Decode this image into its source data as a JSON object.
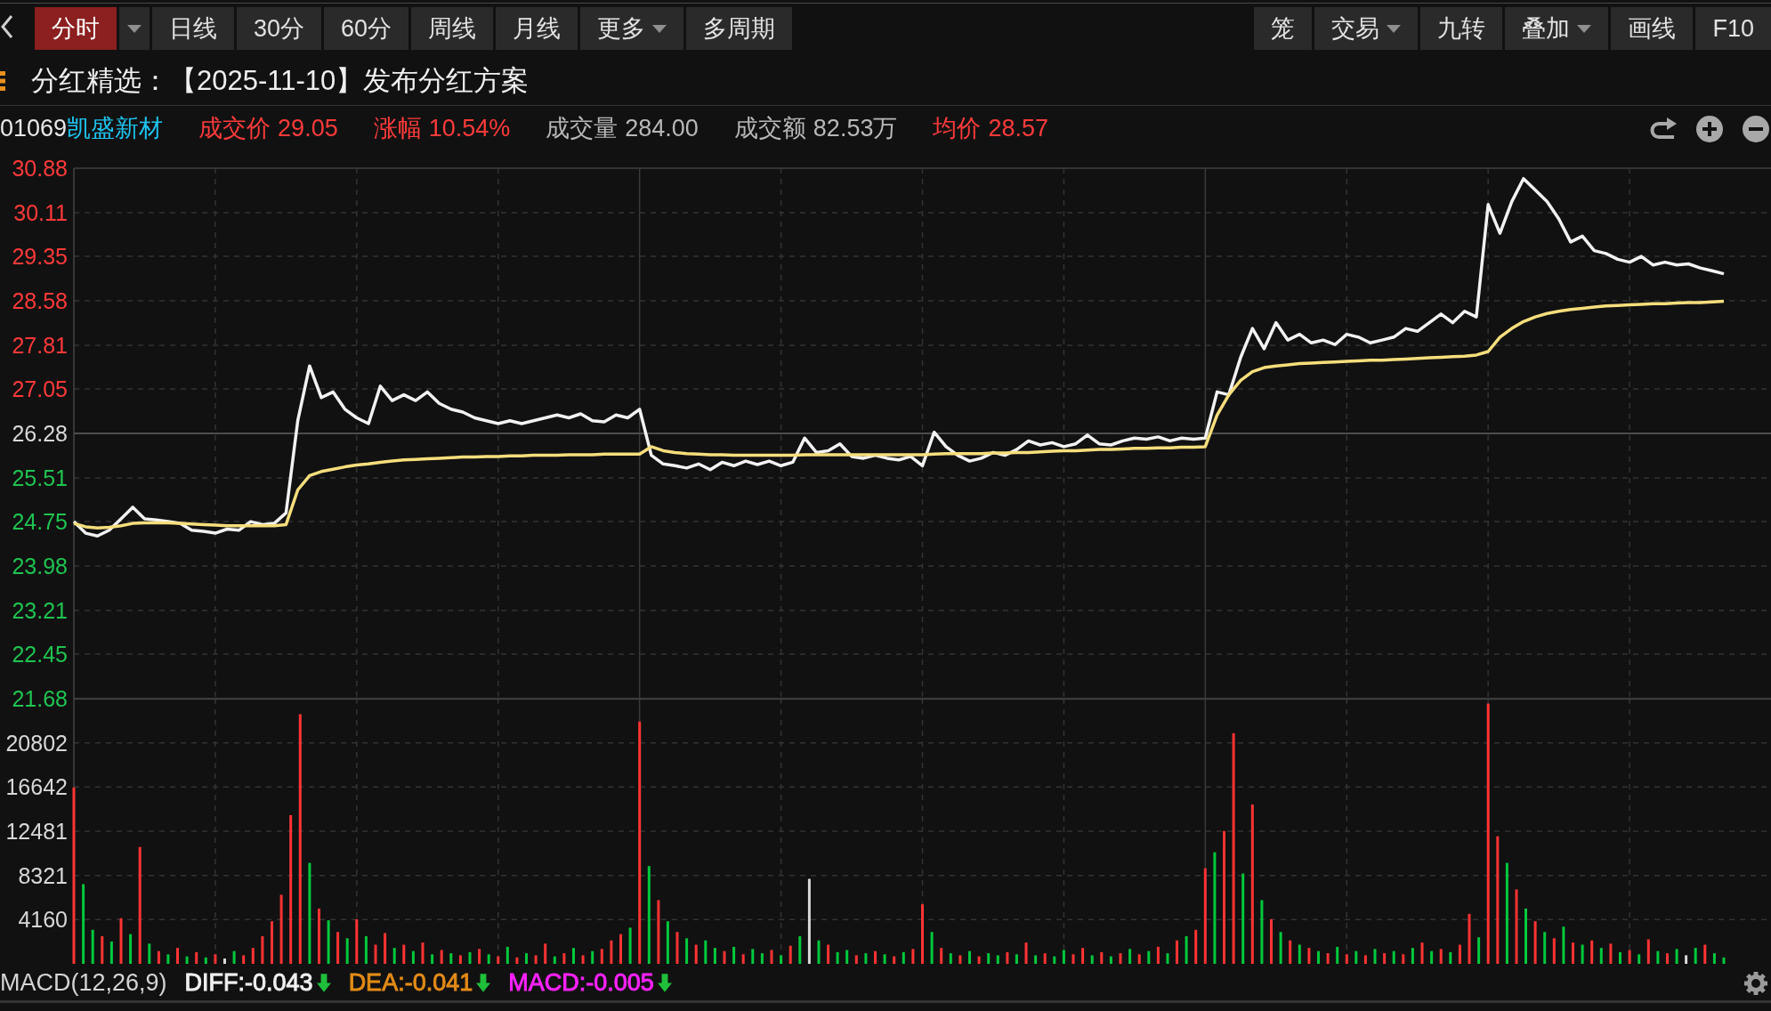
{
  "toolbar": {
    "tabs": [
      {
        "label": "分时",
        "selected": true,
        "kind": "split"
      },
      {
        "label": "日线",
        "selected": false,
        "kind": "plain"
      },
      {
        "label": "30分",
        "selected": false,
        "kind": "plain"
      },
      {
        "label": "60分",
        "selected": false,
        "kind": "plain"
      },
      {
        "label": "周线",
        "selected": false,
        "kind": "plain"
      },
      {
        "label": "月线",
        "selected": false,
        "kind": "plain"
      },
      {
        "label": "更多",
        "selected": false,
        "kind": "dropdown"
      },
      {
        "label": "多周期",
        "selected": false,
        "kind": "plain"
      }
    ],
    "tools": [
      {
        "label": "笼",
        "kind": "plain"
      },
      {
        "label": "交易",
        "kind": "dropdown"
      },
      {
        "label": "九转",
        "kind": "plain"
      },
      {
        "label": "叠加",
        "kind": "dropdown"
      },
      {
        "label": "画线",
        "kind": "plain"
      },
      {
        "label": "F10",
        "kind": "plain"
      }
    ]
  },
  "announcement": "分红精选：【2025-11-10】发布分红方案",
  "quote": {
    "code": "01069",
    "name": "凯盛新材",
    "fields": [
      {
        "label": "成交价",
        "value": "29.05",
        "kind": "up"
      },
      {
        "label": "涨幅",
        "value": "10.54%",
        "kind": "up"
      },
      {
        "label": "成交量",
        "value": "284.00",
        "kind": "flat"
      },
      {
        "label": "成交额",
        "value": "82.53万",
        "kind": "flat"
      },
      {
        "label": "均价",
        "value": "28.57",
        "kind": "up"
      }
    ]
  },
  "chart": {
    "chart_data": [
      {
        "type": "line",
        "categories": [
          null,
          null,
          null,
          null,
          null,
          null,
          null,
          null,
          null,
          null,
          null,
          null,
          null,
          null,
          null,
          null,
          null,
          null,
          null,
          null,
          null,
          null,
          null,
          null,
          null,
          null,
          null,
          null,
          null,
          null,
          null,
          null,
          null,
          null,
          null,
          null,
          null,
          null,
          null,
          null,
          null,
          null,
          null,
          null,
          null,
          null,
          null,
          null,
          null,
          null,
          null,
          null,
          null,
          null,
          null,
          null,
          null,
          null,
          null,
          null,
          null,
          null,
          null,
          null,
          null,
          null,
          null,
          null,
          null,
          null,
          null,
          null,
          null,
          null,
          null,
          null,
          null,
          null,
          null,
          null,
          null,
          null,
          null,
          null,
          null,
          null,
          null,
          null,
          null,
          null,
          null,
          null,
          null,
          null,
          null,
          null,
          null,
          null,
          null,
          null,
          null,
          null,
          null,
          null,
          null,
          null,
          null,
          null,
          null,
          null,
          null,
          null,
          null,
          null,
          null,
          null,
          null,
          null,
          null,
          null,
          null,
          null,
          null,
          null,
          null,
          null,
          null,
          null,
          null,
          null,
          null,
          null,
          null,
          null,
          null,
          null,
          null,
          null,
          null,
          null,
          null,
          null,
          null,
          null,
          null
        ],
        "ylim": [
          21.68,
          30.88
        ],
        "yticks": [
          30.88,
          30.11,
          29.35,
          28.58,
          27.81,
          27.05,
          26.28,
          25.51,
          24.75,
          23.98,
          23.21,
          22.45,
          21.68
        ],
        "tick_labels": "y",
        "grid": true,
        "ref_lines": [
          {
            "axis": "y",
            "value": 26.28,
            "line_style": "solid"
          }
        ],
        "series": [
          {
            "color": "#f2f2f2",
            "values": [
              24.75,
              24.55,
              24.5,
              24.6,
              24.8,
              25.0,
              24.8,
              24.78,
              24.75,
              24.72,
              24.6,
              24.58,
              24.55,
              24.62,
              24.6,
              24.75,
              24.7,
              24.72,
              24.9,
              26.5,
              27.45,
              26.9,
              27.0,
              26.7,
              26.55,
              26.45,
              27.1,
              26.85,
              26.95,
              26.85,
              27.0,
              26.8,
              26.7,
              26.65,
              26.55,
              26.5,
              26.45,
              26.5,
              26.45,
              26.5,
              26.55,
              26.6,
              26.55,
              26.62,
              26.5,
              26.48,
              26.6,
              26.55,
              26.7,
              25.9,
              25.75,
              25.72,
              25.68,
              25.75,
              25.65,
              25.78,
              25.72,
              25.8,
              25.74,
              25.8,
              25.72,
              25.78,
              26.2,
              25.95,
              25.98,
              26.1,
              25.88,
              25.85,
              25.9,
              25.85,
              25.82,
              25.88,
              25.72,
              26.3,
              26.05,
              25.9,
              25.8,
              25.85,
              25.95,
              25.9,
              26.0,
              26.15,
              26.08,
              26.12,
              26.05,
              26.1,
              26.25,
              26.1,
              26.08,
              26.15,
              26.2,
              26.18,
              26.22,
              26.15,
              26.2,
              26.18,
              26.2,
              27.0,
              26.95,
              27.6,
              28.1,
              27.75,
              28.2,
              27.9,
              28.0,
              27.85,
              27.9,
              27.82,
              28.0,
              27.95,
              27.85,
              27.9,
              27.95,
              28.1,
              28.05,
              28.2,
              28.35,
              28.2,
              28.4,
              28.3,
              30.25,
              29.75,
              30.3,
              30.7,
              30.5,
              30.3,
              30.0,
              29.6,
              29.7,
              29.45,
              29.4,
              29.3,
              29.25,
              29.35,
              29.2,
              29.25,
              29.2,
              29.22,
              29.15,
              29.1,
              29.05,
              null,
              null,
              null,
              null
            ]
          },
          {
            "color": "#f6de7c",
            "values": [
              24.72,
              24.66,
              24.64,
              24.65,
              24.68,
              24.72,
              24.73,
              24.73,
              24.73,
              24.72,
              24.71,
              24.7,
              24.69,
              24.68,
              24.68,
              24.68,
              24.68,
              24.68,
              24.7,
              25.3,
              25.55,
              25.62,
              25.66,
              25.7,
              25.73,
              25.75,
              25.78,
              25.8,
              25.82,
              25.83,
              25.84,
              25.85,
              25.86,
              25.87,
              25.87,
              25.88,
              25.88,
              25.89,
              25.89,
              25.9,
              25.9,
              25.9,
              25.91,
              25.91,
              25.91,
              25.92,
              25.92,
              25.92,
              25.92,
              26.05,
              25.98,
              25.95,
              25.93,
              25.92,
              25.91,
              25.91,
              25.9,
              25.9,
              25.9,
              25.9,
              25.9,
              25.9,
              25.91,
              25.91,
              25.91,
              25.91,
              25.91,
              25.91,
              25.91,
              25.91,
              25.91,
              25.91,
              25.91,
              25.92,
              25.93,
              25.93,
              25.93,
              25.93,
              25.94,
              25.94,
              25.95,
              25.95,
              25.96,
              25.97,
              25.98,
              25.98,
              25.99,
              26.0,
              26.0,
              26.01,
              26.02,
              26.02,
              26.03,
              26.03,
              26.04,
              26.04,
              26.05,
              26.6,
              26.95,
              27.2,
              27.35,
              27.42,
              27.45,
              27.47,
              27.49,
              27.5,
              27.51,
              27.52,
              27.53,
              27.54,
              27.55,
              27.55,
              27.56,
              27.57,
              27.58,
              27.59,
              27.6,
              27.61,
              27.62,
              27.64,
              27.7,
              27.95,
              28.1,
              28.22,
              28.3,
              28.36,
              28.4,
              28.43,
              28.45,
              28.47,
              28.49,
              28.5,
              28.51,
              28.52,
              28.53,
              28.53,
              28.54,
              28.55,
              28.55,
              28.56,
              28.57,
              null,
              null,
              null,
              null
            ]
          }
        ]
      },
      {
        "type": "bar",
        "categories": [
          null,
          null,
          null,
          null,
          null,
          null,
          null,
          null,
          null,
          null,
          null,
          null,
          null,
          null,
          null,
          null,
          null,
          null,
          null,
          null,
          null,
          null,
          null,
          null,
          null,
          null,
          null,
          null,
          null,
          null,
          null,
          null,
          null,
          null,
          null,
          null,
          null,
          null,
          null,
          null,
          null,
          null,
          null,
          null,
          null,
          null,
          null,
          null,
          null,
          null,
          null,
          null,
          null,
          null,
          null,
          null,
          null,
          null,
          null,
          null,
          null,
          null,
          null,
          null,
          null,
          null,
          null,
          null,
          null,
          null,
          null,
          null,
          null,
          null,
          null,
          null,
          null,
          null,
          null,
          null,
          null,
          null,
          null,
          null,
          null,
          null,
          null,
          null,
          null,
          null,
          null,
          null,
          null,
          null,
          null,
          null,
          null,
          null,
          null,
          null,
          null,
          null,
          null,
          null,
          null,
          null,
          null,
          null,
          null,
          null,
          null,
          null,
          null,
          null,
          null,
          null,
          null,
          null,
          null,
          null,
          null,
          null,
          null,
          null,
          null,
          null,
          null,
          null,
          null,
          null,
          null,
          null,
          null,
          null,
          null,
          null,
          null,
          null,
          null,
          null,
          null,
          null,
          null,
          null,
          null,
          null,
          null,
          null,
          null,
          null,
          null,
          null,
          null,
          null,
          null,
          null,
          null,
          null,
          null,
          null,
          null,
          null,
          null,
          null,
          null,
          null,
          null,
          null,
          null,
          null,
          null,
          null,
          null,
          null,
          null,
          null,
          null,
          null,
          null,
          null,
          null
        ],
        "ylim": [
          0,
          24962
        ],
        "yticks": [
          20802,
          16642,
          12481,
          8321,
          4160
        ],
        "tick_labels": "y",
        "grid": true,
        "values": [
          16600,
          7500,
          3200,
          2600,
          2100,
          4300,
          2800,
          11000,
          1900,
          1200,
          900,
          1500,
          700,
          1100,
          600,
          900,
          500,
          1200,
          800,
          1500,
          2600,
          4000,
          6500,
          14000,
          23500,
          9500,
          5200,
          4100,
          3000,
          2400,
          4200,
          2600,
          1800,
          2900,
          1500,
          1800,
          1200,
          2000,
          900,
          1300,
          1000,
          800,
          1100,
          1400,
          900,
          700,
          1600,
          600,
          1000,
          800,
          1900,
          700,
          1000,
          1500,
          800,
          1200,
          1400,
          2200,
          2800,
          3400,
          22800,
          9200,
          6000,
          4000,
          3000,
          2400,
          1800,
          2200,
          1500,
          1200,
          1600,
          900,
          1400,
          1000,
          1300,
          800,
          1700,
          2600,
          8000,
          2200,
          1800,
          1100,
          1300,
          800,
          1000,
          1200,
          900,
          700,
          1100,
          1400,
          5600,
          3000,
          1500,
          1000,
          800,
          1200,
          700,
          1000,
          800,
          1100,
          900,
          2000,
          800,
          1000,
          700,
          1300,
          900,
          1500,
          800,
          1100,
          700,
          1000,
          1400,
          900,
          1200,
          1600,
          1000,
          2200,
          2600,
          3200,
          9000,
          10500,
          12500,
          21700,
          8500,
          15000,
          6000,
          4200,
          3000,
          2200,
          1800,
          1500,
          1200,
          1000,
          1600,
          900,
          1200,
          800,
          1400,
          1000,
          1200,
          900,
          1500,
          2000,
          1200,
          1400,
          1100,
          1800,
          4700,
          2500,
          24500,
          12000,
          9500,
          7000,
          5200,
          4000,
          3000,
          2400,
          3500,
          2000,
          1800,
          2200,
          1500,
          1900,
          1100,
          1300,
          900,
          2300,
          1200,
          1000,
          1400,
          800,
          1500,
          1800,
          1000,
          600,
          null,
          null,
          null,
          null,
          null
        ],
        "colors": [
          "#ff3333",
          "#00c93c",
          "#00c93c",
          "#ff3333",
          "#00c93c",
          "#ff3333",
          "#00c93c",
          "#ff3333",
          "#00c93c",
          "#ff3333",
          "#00c93c",
          "#ff3333",
          "#00c93c",
          "#ff3333",
          "#00c93c",
          "#ff3333",
          "#d9d9d9",
          "#00c93c",
          "#ff3333",
          "#ff3333",
          "#ff3333",
          "#ff3333",
          "#ff3333",
          "#ff3333",
          "#ff3333",
          "#00c93c",
          "#ff3333",
          "#00c93c",
          "#ff3333",
          "#00c93c",
          "#ff3333",
          "#00c93c",
          "#ff3333",
          "#ff3333",
          "#00c93c",
          "#ff3333",
          "#00c93c",
          "#ff3333",
          "#00c93c",
          "#ff3333",
          "#00c93c",
          "#ff3333",
          "#00c93c",
          "#ff3333",
          "#00c93c",
          "#ff3333",
          "#00c93c",
          "#ff3333",
          "#00c93c",
          "#ff3333",
          "#ff3333",
          "#00c93c",
          "#ff3333",
          "#00c93c",
          "#ff3333",
          "#00c93c",
          "#ff3333",
          "#ff3333",
          "#ff3333",
          "#00c93c",
          "#ff3333",
          "#00c93c",
          "#ff3333",
          "#00c93c",
          "#ff3333",
          "#00c93c",
          "#ff3333",
          "#00c93c",
          "#00c93c",
          "#ff3333",
          "#00c93c",
          "#ff3333",
          "#00c93c",
          "#00c93c",
          "#ff3333",
          "#00c93c",
          "#ff3333",
          "#00c93c",
          "#d9d9d9",
          "#00c93c",
          "#ff3333",
          "#00c93c",
          "#00c93c",
          "#ff3333",
          "#00c93c",
          "#ff3333",
          "#00c93c",
          "#ff3333",
          "#00c93c",
          "#ff3333",
          "#ff3333",
          "#00c93c",
          "#ff3333",
          "#00c93c",
          "#ff3333",
          "#00c93c",
          "#ff3333",
          "#00c93c",
          "#00c93c",
          "#ff3333",
          "#00c93c",
          "#ff3333",
          "#00c93c",
          "#ff3333",
          "#00c93c",
          "#00c93c",
          "#ff3333",
          "#ff3333",
          "#00c93c",
          "#ff3333",
          "#00c93c",
          "#ff3333",
          "#00c93c",
          "#ff3333",
          "#00c93c",
          "#ff3333",
          "#00c93c",
          "#ff3333",
          "#00c93c",
          "#ff3333",
          "#ff3333",
          "#00c93c",
          "#ff3333",
          "#ff3333",
          "#00c93c",
          "#ff3333",
          "#00c93c",
          "#ff3333",
          "#00c93c",
          "#ff3333",
          "#00c93c",
          "#ff3333",
          "#00c93c",
          "#ff3333",
          "#00c93c",
          "#ff3333",
          "#00c93c",
          "#ff3333",
          "#00c93c",
          "#ff3333",
          "#00c93c",
          "#ff3333",
          "#00c93c",
          "#ff3333",
          "#00c93c",
          "#ff3333",
          "#00c93c",
          "#ff3333",
          "#ff3333",
          "#00c93c",
          "#ff3333",
          "#ff3333",
          "#00c93c",
          "#ff3333",
          "#00c93c",
          "#ff3333",
          "#00c93c",
          "#ff3333",
          "#00c93c",
          "#ff3333",
          "#00c93c",
          "#ff3333",
          "#00c93c",
          "#ff3333",
          "#00c93c",
          "#ff3333",
          "#00c93c",
          "#ff3333",
          "#00c93c",
          "#ff3333",
          "#00c93c",
          "#d9d9d9",
          "#00c93c",
          "#ff3333",
          "#00c93c",
          "#00c93c",
          null,
          null,
          null,
          null,
          null
        ]
      }
    ]
  },
  "indicator": {
    "name": "MACD(12,26,9)",
    "values": [
      {
        "label": "DIFF:-0.043",
        "color": "#f0f0f0",
        "falling": true
      },
      {
        "label": "DEA:-0.041",
        "color": "#e38b17",
        "falling": true
      },
      {
        "label": "MACD:-0.005",
        "color": "#ff22ff",
        "falling": true
      }
    ]
  }
}
